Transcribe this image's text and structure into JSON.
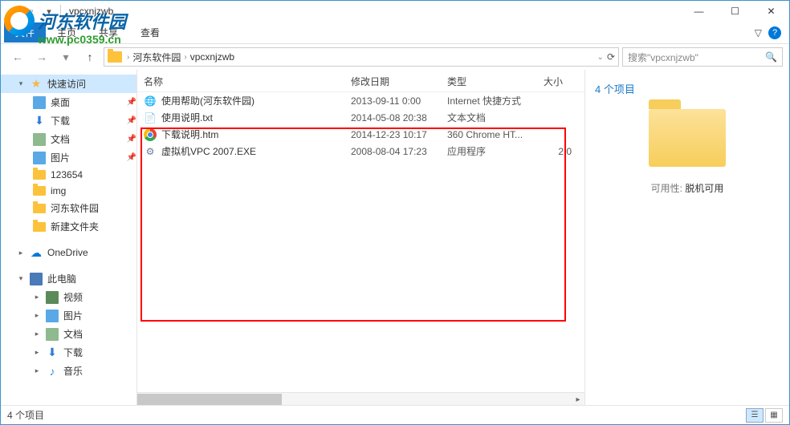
{
  "window": {
    "title": "vpcxnjzwb",
    "watermark_text": "河东软件园",
    "watermark_url": "www.pc0359.cn"
  },
  "ribbon": {
    "file": "文件",
    "tabs": [
      "主页",
      "共享",
      "查看"
    ],
    "expand": "▽",
    "help": "?"
  },
  "address": {
    "crumbs": [
      "河东软件园",
      "vpcxnjzwb"
    ],
    "search_placeholder": "搜索\"vpcxnjzwb\""
  },
  "sidebar": {
    "quick": "快速访问",
    "items": [
      {
        "label": "桌面",
        "pin": true,
        "ico": "desktop"
      },
      {
        "label": "下载",
        "pin": true,
        "ico": "download"
      },
      {
        "label": "文档",
        "pin": true,
        "ico": "doc"
      },
      {
        "label": "图片",
        "pin": true,
        "ico": "pic"
      },
      {
        "label": "123654",
        "pin": false,
        "ico": "folder"
      },
      {
        "label": "img",
        "pin": false,
        "ico": "folder"
      },
      {
        "label": "河东软件园",
        "pin": false,
        "ico": "folder"
      },
      {
        "label": "新建文件夹",
        "pin": false,
        "ico": "folder"
      }
    ],
    "onedrive": "OneDrive",
    "thispc": "此电脑",
    "pc_items": [
      {
        "label": "视频",
        "ico": "video"
      },
      {
        "label": "图片",
        "ico": "pic"
      },
      {
        "label": "文档",
        "ico": "doc"
      },
      {
        "label": "下载",
        "ico": "download"
      },
      {
        "label": "音乐",
        "ico": "music"
      }
    ]
  },
  "columns": {
    "name": "名称",
    "date": "修改日期",
    "type": "类型",
    "size": "大小"
  },
  "files": [
    {
      "name": "使用帮助(河东软件园)",
      "date": "2013-09-11 0:00",
      "type": "Internet 快捷方式",
      "size": "",
      "ico": "ie"
    },
    {
      "name": "使用说明.txt",
      "date": "2014-05-08 20:38",
      "type": "文本文档",
      "size": "",
      "ico": "txt"
    },
    {
      "name": "下载说明.htm",
      "date": "2014-12-23 10:17",
      "type": "360 Chrome HT...",
      "size": "",
      "ico": "chrome"
    },
    {
      "name": "虚拟机VPC 2007.EXE",
      "date": "2008-08-04 17:23",
      "type": "应用程序",
      "size": "2,0",
      "ico": "exe"
    }
  ],
  "preview": {
    "title": "4 个项目",
    "avail_label": "可用性:",
    "avail_value": "脱机可用"
  },
  "status": {
    "text": "4 个项目"
  }
}
